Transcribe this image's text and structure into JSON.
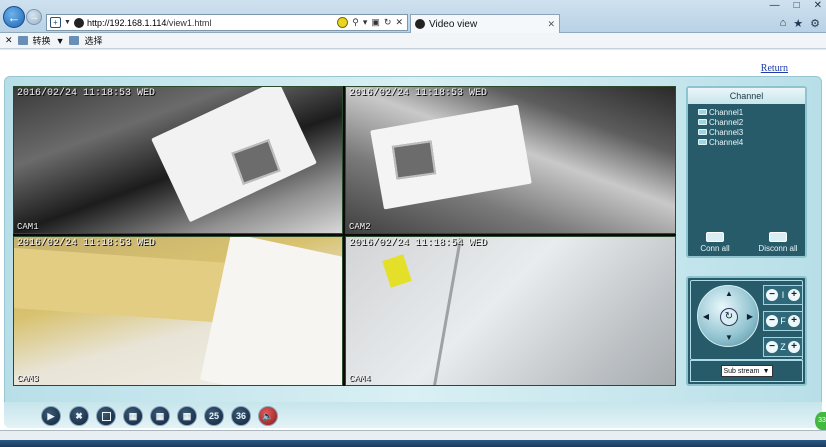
{
  "browser": {
    "url_prefix": "http://192.168.1.114",
    "url_path": "/view1.html",
    "tab_title": "Video view",
    "command_bar": {
      "item1": "转换",
      "item2": "选择"
    }
  },
  "page": {
    "return_link": "Return"
  },
  "cameras": [
    {
      "osd": "2016/02/24 11:18:53 WED",
      "label": "CAM1"
    },
    {
      "osd": "2016/02/24 11:18:53 WED",
      "label": "CAM2"
    },
    {
      "osd": "2016/02/24 11:18:53 WED",
      "label": "CAM3"
    },
    {
      "osd": "2016/02/24 11:18:54 WED",
      "label": "CAM4"
    }
  ],
  "channel_panel": {
    "title": "Channel",
    "channels": [
      "Channel1",
      "Channel2",
      "Channel3",
      "Channel4"
    ],
    "conn_all": "Conn all",
    "disconn_all": "Disconn all"
  },
  "ptz": {
    "iris_label": "I",
    "focus_label": "F",
    "zoom_label": "Z",
    "stream_value": "Sub stream"
  },
  "toolbar": {
    "btn_25": "25",
    "btn_36": "36"
  },
  "taskbar": {
    "badge": "33"
  }
}
